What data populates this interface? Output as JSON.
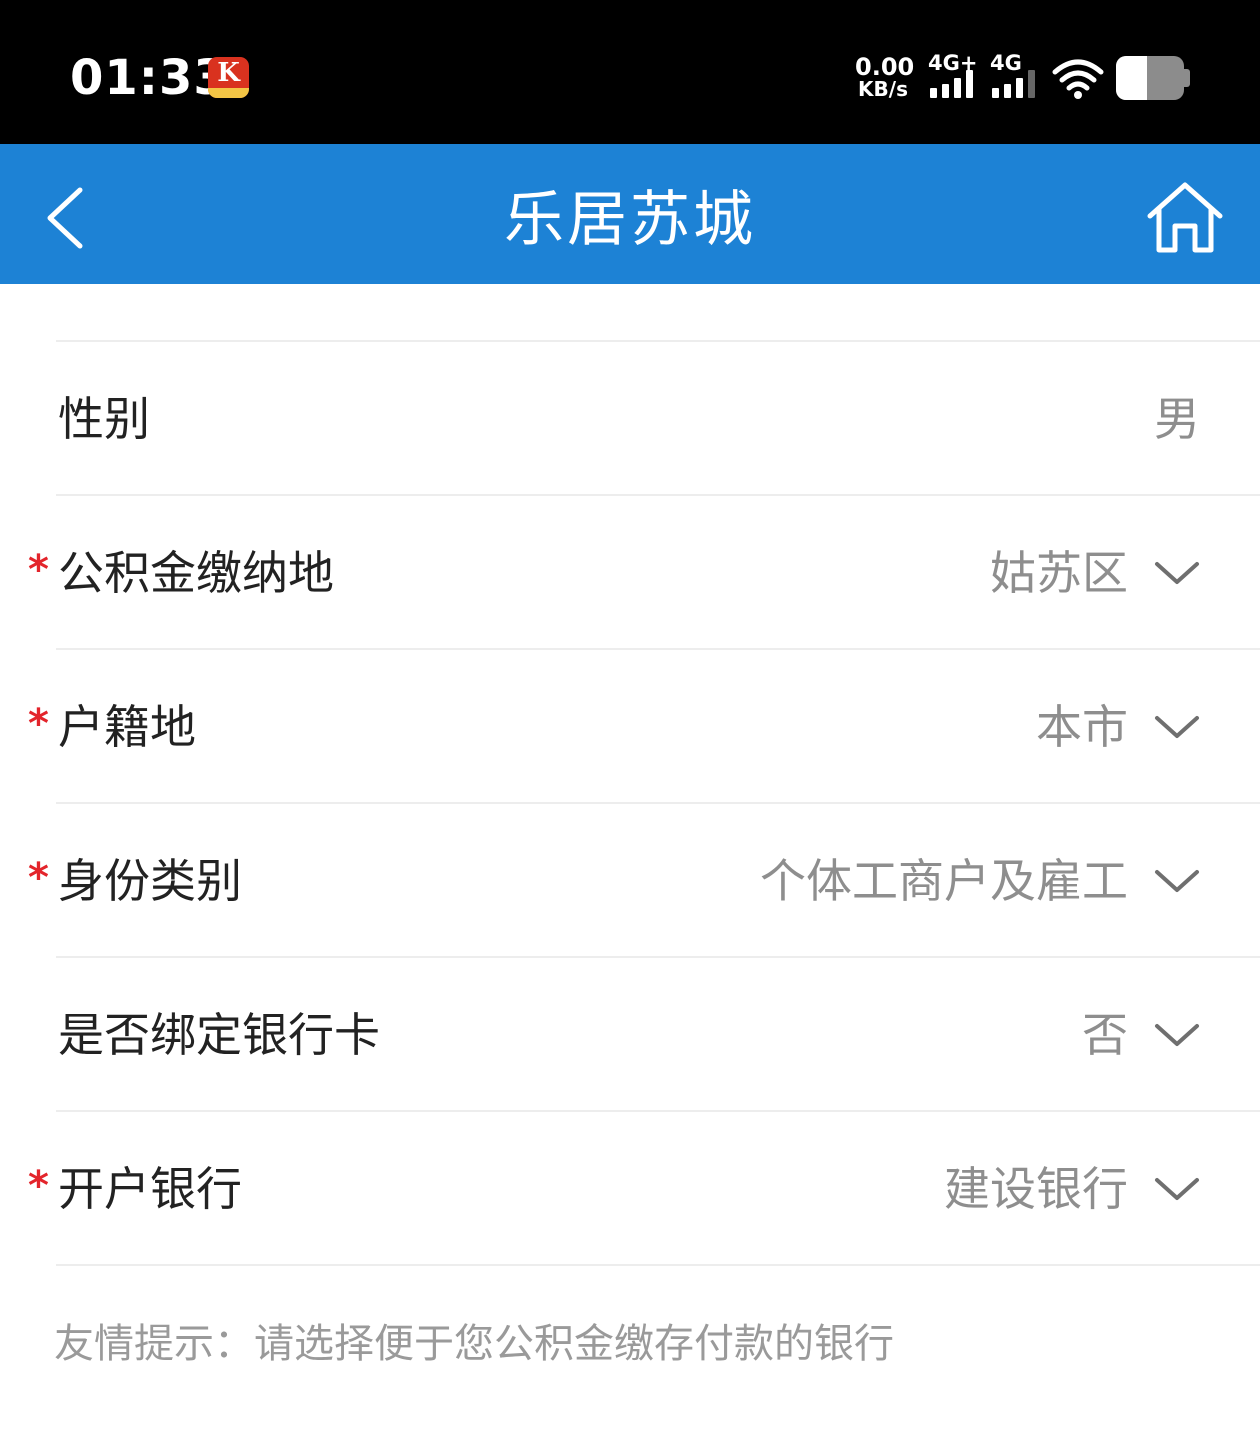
{
  "status_bar": {
    "time": "01:33",
    "net_speed_value": "0.00",
    "net_speed_unit": "KB/s",
    "sim1_label": "4G+",
    "sim2_label": "4G",
    "battery_level": 0.45
  },
  "header": {
    "title": "乐居苏城",
    "back_icon": "chevron-left-icon",
    "home_icon": "home-icon",
    "background_color": "#1d82d5"
  },
  "form": {
    "rows": [
      {
        "label": "性别",
        "value": "男",
        "required": false,
        "dropdown": false
      },
      {
        "label": "公积金缴纳地",
        "value": "姑苏区",
        "required": true,
        "dropdown": true
      },
      {
        "label": "户籍地",
        "value": "本市",
        "required": true,
        "dropdown": true
      },
      {
        "label": "身份类别",
        "value": "个体工商户及雇工",
        "required": true,
        "dropdown": true
      },
      {
        "label": "是否绑定银行卡",
        "value": "否",
        "required": false,
        "dropdown": true
      },
      {
        "label": "开户银行",
        "value": "建设银行",
        "required": true,
        "dropdown": true
      }
    ],
    "required_mark": "*",
    "required_color": "#e3242b",
    "tip": "友情提示：请选择便于您公积金缴存付款的银行"
  }
}
